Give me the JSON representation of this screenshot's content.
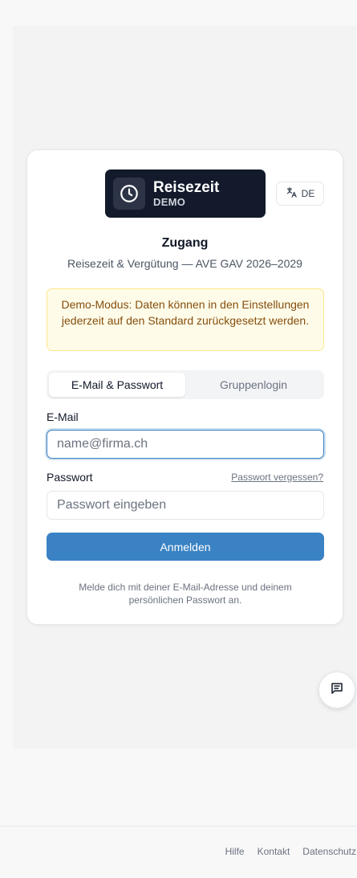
{
  "app": {
    "name": "Reisezeit",
    "badge": "DEMO"
  },
  "language": {
    "label": "DE"
  },
  "login": {
    "title": "Zugang",
    "subtitle": "Reisezeit & Vergütung — AVE GAV 2026–2029",
    "notice": "Demo-Modus: Daten können in den Einstellungen jederzeit auf den Standard zurückgesetzt werden.",
    "tabs": [
      {
        "label": "E-Mail & Passwort",
        "active": true
      },
      {
        "label": "Gruppenlogin",
        "active": false
      }
    ],
    "email": {
      "label": "E-Mail",
      "value": "",
      "placeholder": "name@firma.ch"
    },
    "password": {
      "label": "Passwort",
      "value": "",
      "placeholder": "Passwort eingeben",
      "forgot_label": "Passwort vergessen?"
    },
    "submit_label": "Anmelden",
    "hint": "Melde dich mit deiner E-Mail-Adresse und deinem persönlichen Passwort an."
  },
  "footer": {
    "links": [
      "Hilfe",
      "Kontakt",
      "Datenschutz"
    ]
  },
  "colors": {
    "primary": "#3a82c4",
    "logo_bg": "#121a2b",
    "notice_bg": "#fefce8",
    "notice_text": "#854d0e"
  },
  "icons": {
    "logo": "clock-icon",
    "language": "translate-icon",
    "feedback": "message-icon"
  }
}
